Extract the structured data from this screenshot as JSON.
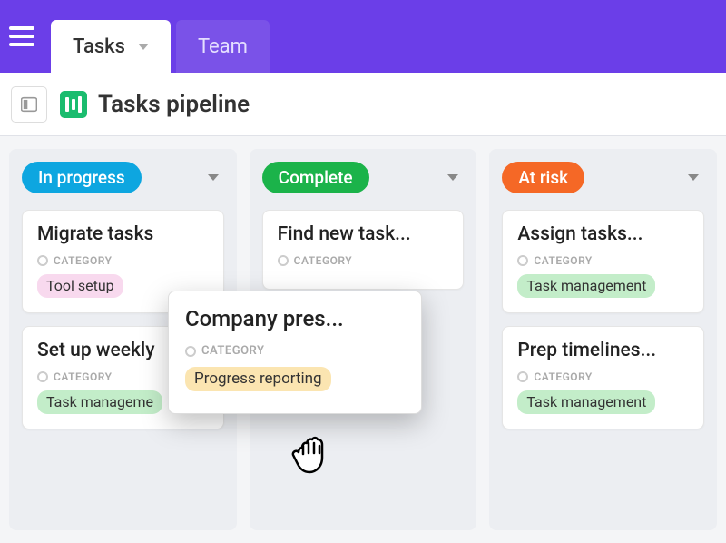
{
  "nav": {
    "tabs": [
      {
        "label": "Tasks",
        "active": true
      },
      {
        "label": "Team",
        "active": false
      }
    ]
  },
  "page": {
    "title": "Tasks pipeline"
  },
  "category_label": "CATEGORY",
  "columns": [
    {
      "status": "In progress",
      "pill_class": "pill-blue",
      "cards": [
        {
          "title": "Migrate tasks",
          "tag": "Tool setup",
          "tag_class": "tag-pink"
        },
        {
          "title": "Set up weekly",
          "tag": "Task manageme",
          "tag_class": "tag-green"
        }
      ]
    },
    {
      "status": "Complete",
      "pill_class": "pill-green",
      "cards": [
        {
          "title": "Find new task...",
          "tag": "",
          "tag_class": ""
        }
      ]
    },
    {
      "status": "At risk",
      "pill_class": "pill-orange",
      "cards": [
        {
          "title": "Assign tasks...",
          "tag": "Task management",
          "tag_class": "tag-green"
        },
        {
          "title": "Prep timelines...",
          "tag": "Task management",
          "tag_class": "tag-green"
        }
      ]
    }
  ],
  "drag_card": {
    "title": "Company pres...",
    "tag": "Progress reporting",
    "tag_class": "tag-yellow"
  }
}
